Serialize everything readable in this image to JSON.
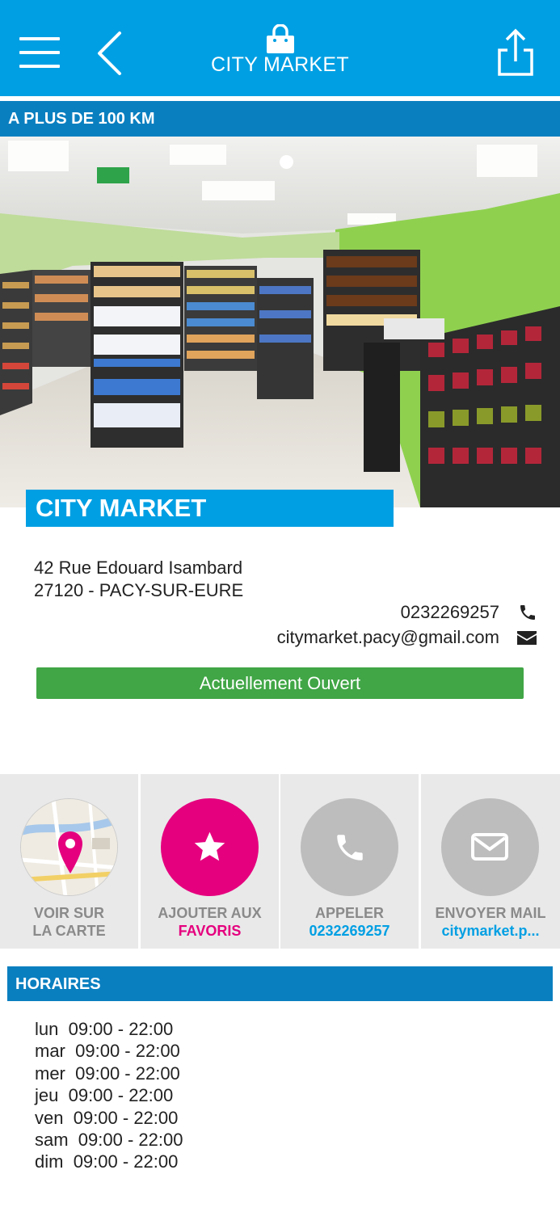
{
  "header": {
    "title": "CITY MARKET",
    "menu_icon": "hamburger-icon",
    "back_icon": "chevron-left-icon",
    "logo_icon": "shopping-bag-icon",
    "share_icon": "share-icon",
    "background": "#009fe3"
  },
  "distance_label": "A PLUS DE 100 KM",
  "store": {
    "name": "CITY MARKET",
    "address_line1": "42 Rue Edouard Isambard",
    "address_line2": "27120 - PACY-SUR-EURE",
    "phone": "0232269257",
    "email": "citymarket.pacy@gmail.com",
    "status": "Actuellement Ouvert",
    "status_color": "#41a646"
  },
  "actions": [
    {
      "line1": "VOIR SUR",
      "line2": "LA CARTE",
      "icon": "map-pin-icon"
    },
    {
      "line1": "AJOUTER AUX",
      "line2": "FAVORIS",
      "icon": "star-icon",
      "color": "#e5007e"
    },
    {
      "line1": "APPELER",
      "line2": "0232269257",
      "icon": "phone-icon",
      "color": "#009fe3"
    },
    {
      "line1": "ENVOYER MAIL",
      "line2": "citymarket.p...",
      "icon": "mail-icon",
      "color": "#009fe3"
    }
  ],
  "hours": {
    "title": "HORAIRES",
    "days": [
      {
        "day": "lun",
        "time": "09:00 - 22:00"
      },
      {
        "day": "mar",
        "time": "09:00 - 22:00"
      },
      {
        "day": "mer",
        "time": "09:00 - 22:00"
      },
      {
        "day": "jeu",
        "time": "09:00 - 22:00"
      },
      {
        "day": "ven",
        "time": "09:00 - 22:00"
      },
      {
        "day": "sam",
        "time": "09:00 - 22:00"
      },
      {
        "day": "dim",
        "time": "09:00 - 22:00"
      }
    ]
  }
}
